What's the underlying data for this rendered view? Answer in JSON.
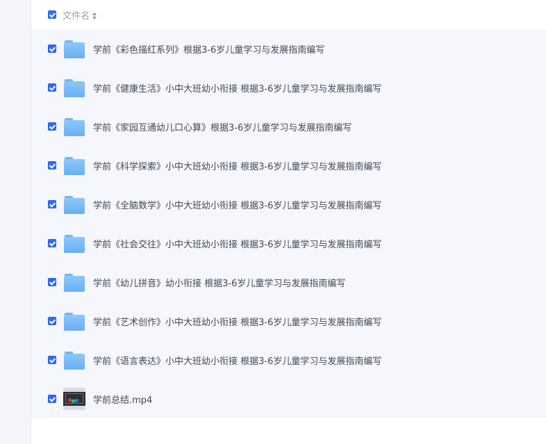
{
  "header": {
    "column_label": "文件名",
    "select_all_checked": true
  },
  "files": [
    {
      "name": "学前《彩色描红系列》根据3-6岁儿童学习与发展指南编写",
      "type": "folder",
      "checked": true
    },
    {
      "name": "学前《健康生活》小中大班幼小衔接 根据3-6岁儿童学习与发展指南编写",
      "type": "folder",
      "checked": true
    },
    {
      "name": "学前《家园互通幼儿口心算》根据3-6岁儿童学习与发展指南编写",
      "type": "folder",
      "checked": true
    },
    {
      "name": "学前《科学探索》小中大班幼小衔接 根据3-6岁儿童学习与发展指南编写",
      "type": "folder",
      "checked": true
    },
    {
      "name": "学前《全脑数学》小中大班幼小衔接 根据3-6岁儿童学习与发展指南编写",
      "type": "folder",
      "checked": true
    },
    {
      "name": "学前《社会交往》小中大班幼小衔接 根据3-6岁儿童学习与发展指南编写",
      "type": "folder",
      "checked": true
    },
    {
      "name": "学前《幼儿拼音》幼小衔接 根据3-6岁儿童学习与发展指南编写",
      "type": "folder",
      "checked": true
    },
    {
      "name": "学前《艺术创作》小中大班幼小衔接 根据3-6岁儿童学习与发展指南编写",
      "type": "folder",
      "checked": true
    },
    {
      "name": "学前《语言表达》小中大班幼小衔接 根据3-6岁儿童学习与发展指南编写",
      "type": "folder",
      "checked": true
    },
    {
      "name": "学前总结.mp4",
      "type": "video",
      "checked": true
    }
  ]
}
